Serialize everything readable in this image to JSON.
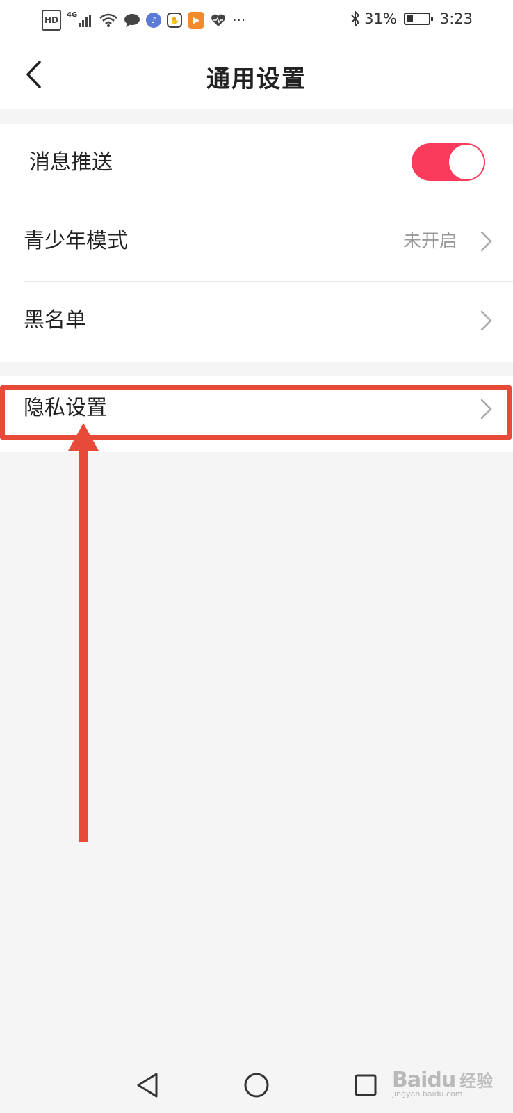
{
  "status_bar": {
    "hd": "HD",
    "network": "4G",
    "battery_percent": "31%",
    "battery_level": 0.31,
    "time": "3:23",
    "more": "···",
    "icons": [
      "hd-icon",
      "signal-icon",
      "wifi-icon",
      "chat-bubble-icon",
      "music-icon",
      "hex-app-icon",
      "video-app-icon",
      "health-heart-icon",
      "bluetooth-icon",
      "battery-charging-icon"
    ]
  },
  "header": {
    "title": "通用设置",
    "back_icon": "chevron-left-icon"
  },
  "settings": {
    "items": [
      {
        "label": "消息推送",
        "control": "toggle",
        "toggle_on": true
      },
      {
        "label": "青少年模式",
        "value": "未开启",
        "control": "chevron"
      },
      {
        "label": "黑名单",
        "control": "chevron"
      },
      {
        "label": "隐私设置",
        "control": "chevron"
      }
    ]
  },
  "annotation": {
    "highlight_color": "#e84a3a",
    "arrow_icon": "arrow-up-icon"
  },
  "colors": {
    "toggle_on": "#fb3b5b",
    "background": "#f5f5f5",
    "row_background": "#ffffff",
    "value_text": "#9a9a9a"
  },
  "nav_bar": {
    "back_icon": "triangle-back-icon",
    "home_icon": "circle-home-icon",
    "recents_icon": "square-recents-icon"
  },
  "watermark": {
    "logo": "Baidu",
    "cn": "经验",
    "url": "jingyan.baidu.com"
  }
}
